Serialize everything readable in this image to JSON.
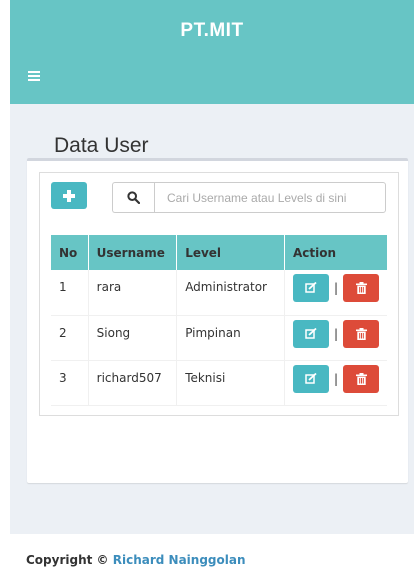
{
  "app": {
    "title": "PT.MIT"
  },
  "page": {
    "title": "Data User"
  },
  "search": {
    "placeholder": "Cari Username atau Levels di sini"
  },
  "table": {
    "headers": {
      "no": "No",
      "username": "Username",
      "level": "Level",
      "action": "Action"
    },
    "rows": [
      {
        "no": "1",
        "username": "rara",
        "level": "Administrator"
      },
      {
        "no": "2",
        "username": "Siong",
        "level": "Pimpinan"
      },
      {
        "no": "3",
        "username": "richard507",
        "level": "Teknisi"
      }
    ],
    "separator": "|"
  },
  "footer": {
    "prefix": "Copyright ©",
    "author": "Richard Nainggolan"
  },
  "colors": {
    "accent": "#67c5c5",
    "button_info": "#49b8c2",
    "button_danger": "#dd4b39",
    "link": "#3c8dbc"
  },
  "icons": {
    "menu": "hamburger-icon",
    "add": "plus-icon",
    "search": "search-icon",
    "edit": "edit-icon",
    "delete": "trash-icon"
  }
}
